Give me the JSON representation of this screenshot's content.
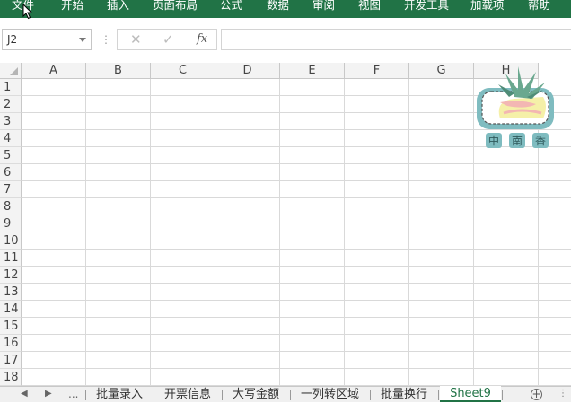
{
  "ribbon": {
    "tabs": [
      "文件",
      "开始",
      "插入",
      "页面布局",
      "公式",
      "数据",
      "审阅",
      "视图",
      "开发工具",
      "加载项",
      "帮助"
    ],
    "color": "#217346"
  },
  "formula_bar": {
    "name_box": "J2",
    "cancel_icon": "cross-icon",
    "enter_icon": "check-icon",
    "fx_label": "fx",
    "formula_value": ""
  },
  "grid": {
    "columns": [
      "A",
      "B",
      "C",
      "D",
      "E",
      "F",
      "G",
      "H"
    ],
    "rows": [
      "1",
      "2",
      "3",
      "4",
      "5",
      "6",
      "7",
      "8",
      "9",
      "10",
      "11",
      "12",
      "13",
      "14",
      "15",
      "16",
      "17",
      "18"
    ]
  },
  "sheet_tabs": {
    "ellipsis": "...",
    "tabs": [
      "批量录入",
      "开票信息",
      "大写金额",
      "一列转区域",
      "批量换行",
      "Sheet9"
    ],
    "active": "Sheet9",
    "accent": "#217346"
  },
  "logo": {
    "characters": [
      "中",
      "南",
      "香"
    ]
  }
}
